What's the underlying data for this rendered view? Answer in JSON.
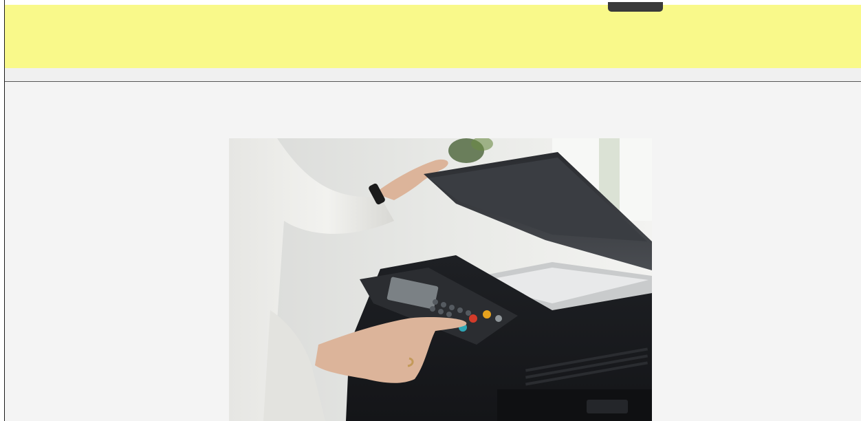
{
  "banner": {
    "background_color": "#f9f98a",
    "tab_color": "#3a3a3a"
  },
  "content": {
    "background_color": "#f4f4f4",
    "image": {
      "subject": "copier-photo",
      "alt": ""
    }
  }
}
